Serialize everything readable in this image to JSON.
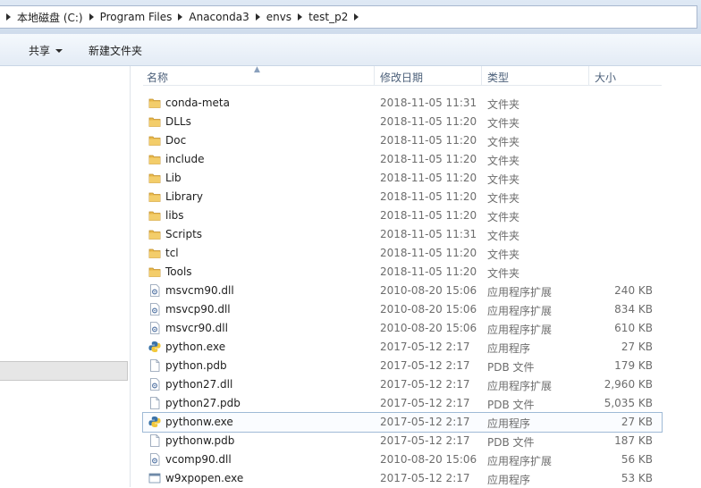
{
  "breadcrumb": [
    "本地磁盘 (C:)",
    "Program Files",
    "Anaconda3",
    "envs",
    "test_p2"
  ],
  "toolbar": {
    "share_label": "共享",
    "new_folder_label": "新建文件夹"
  },
  "columns": {
    "name": "名称",
    "date": "修改日期",
    "type": "类型",
    "size": "大小"
  },
  "files": [
    {
      "name": "conda-meta",
      "date": "2018-11-05 11:31",
      "type": "文件夹",
      "size": "",
      "icon": "folder-icon"
    },
    {
      "name": "DLLs",
      "date": "2018-11-05 11:20",
      "type": "文件夹",
      "size": "",
      "icon": "folder-icon"
    },
    {
      "name": "Doc",
      "date": "2018-11-05 11:20",
      "type": "文件夹",
      "size": "",
      "icon": "folder-icon"
    },
    {
      "name": "include",
      "date": "2018-11-05 11:20",
      "type": "文件夹",
      "size": "",
      "icon": "folder-icon"
    },
    {
      "name": "Lib",
      "date": "2018-11-05 11:20",
      "type": "文件夹",
      "size": "",
      "icon": "folder-icon"
    },
    {
      "name": "Library",
      "date": "2018-11-05 11:20",
      "type": "文件夹",
      "size": "",
      "icon": "folder-icon"
    },
    {
      "name": "libs",
      "date": "2018-11-05 11:20",
      "type": "文件夹",
      "size": "",
      "icon": "folder-icon"
    },
    {
      "name": "Scripts",
      "date": "2018-11-05 11:31",
      "type": "文件夹",
      "size": "",
      "icon": "folder-icon"
    },
    {
      "name": "tcl",
      "date": "2018-11-05 11:20",
      "type": "文件夹",
      "size": "",
      "icon": "folder-icon"
    },
    {
      "name": "Tools",
      "date": "2018-11-05 11:20",
      "type": "文件夹",
      "size": "",
      "icon": "folder-icon"
    },
    {
      "name": "msvcm90.dll",
      "date": "2010-08-20 15:06",
      "type": "应用程序扩展",
      "size": "240 KB",
      "icon": "dll-icon"
    },
    {
      "name": "msvcp90.dll",
      "date": "2010-08-20 15:06",
      "type": "应用程序扩展",
      "size": "834 KB",
      "icon": "dll-icon"
    },
    {
      "name": "msvcr90.dll",
      "date": "2010-08-20 15:06",
      "type": "应用程序扩展",
      "size": "610 KB",
      "icon": "dll-icon"
    },
    {
      "name": "python.exe",
      "date": "2017-05-12 2:17",
      "type": "应用程序",
      "size": "27 KB",
      "icon": "python-icon"
    },
    {
      "name": "python.pdb",
      "date": "2017-05-12 2:17",
      "type": "PDB 文件",
      "size": "179 KB",
      "icon": "file-icon"
    },
    {
      "name": "python27.dll",
      "date": "2017-05-12 2:17",
      "type": "应用程序扩展",
      "size": "2,960 KB",
      "icon": "dll-icon"
    },
    {
      "name": "python27.pdb",
      "date": "2017-05-12 2:17",
      "type": "PDB 文件",
      "size": "5,035 KB",
      "icon": "file-icon"
    },
    {
      "name": "pythonw.exe",
      "date": "2017-05-12 2:17",
      "type": "应用程序",
      "size": "27 KB",
      "icon": "python-icon"
    },
    {
      "name": "pythonw.pdb",
      "date": "2017-05-12 2:17",
      "type": "PDB 文件",
      "size": "187 KB",
      "icon": "file-icon"
    },
    {
      "name": "vcomp90.dll",
      "date": "2010-08-20 15:06",
      "type": "应用程序扩展",
      "size": "56 KB",
      "icon": "dll-icon"
    },
    {
      "name": "w9xpopen.exe",
      "date": "2017-05-12 2:17",
      "type": "应用程序",
      "size": "53 KB",
      "icon": "exe-icon"
    }
  ],
  "selected_file": "pythonw.exe"
}
